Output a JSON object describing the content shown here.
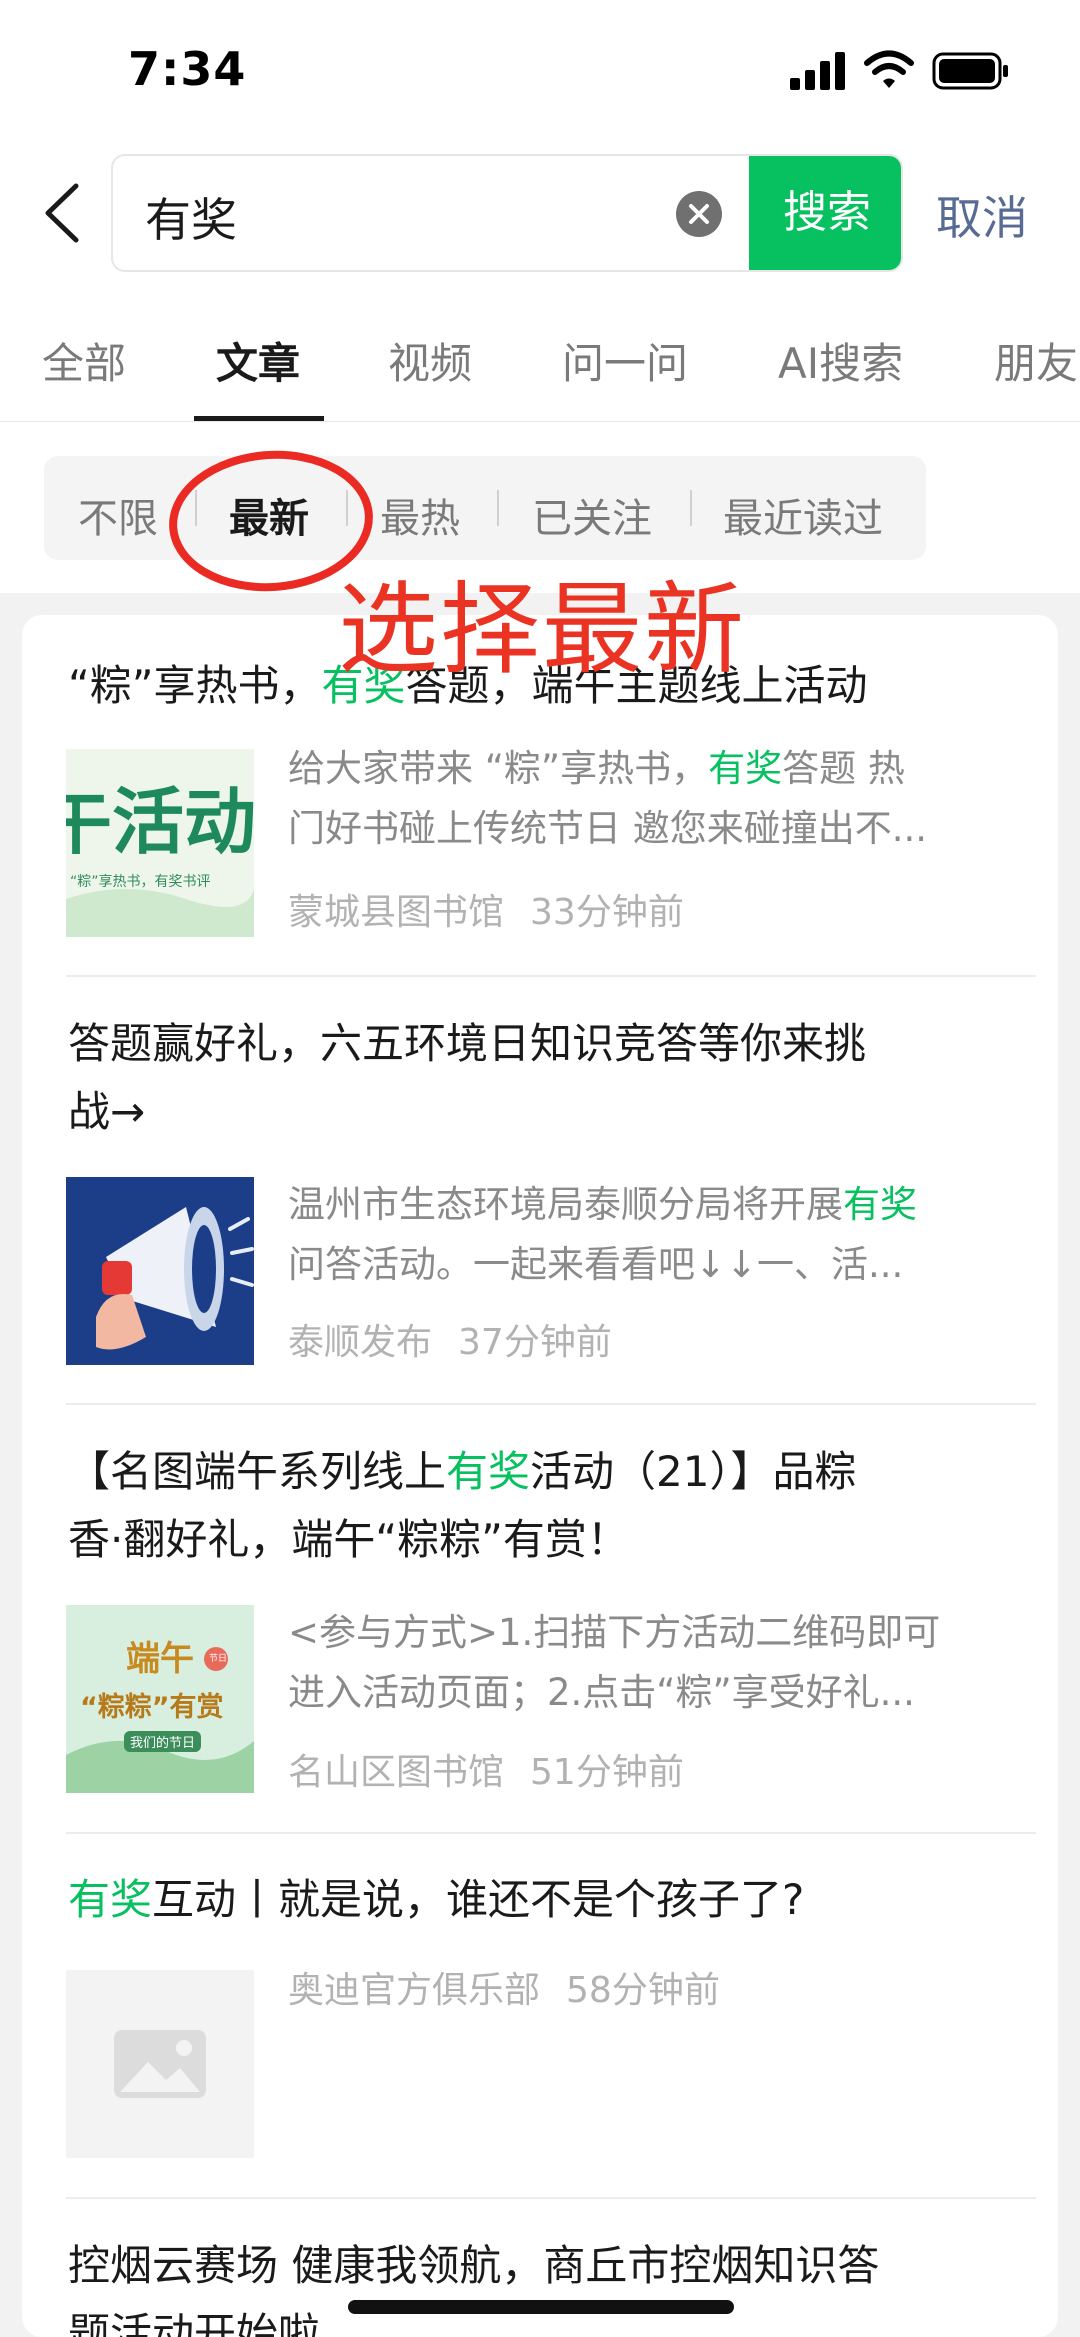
{
  "status_bar": {
    "time": "7:34"
  },
  "search": {
    "query": "有奖",
    "button_label": "搜索",
    "cancel_label": "取消"
  },
  "tabs": [
    {
      "label": "全部",
      "active": false
    },
    {
      "label": "文章",
      "active": true
    },
    {
      "label": "视频",
      "active": false
    },
    {
      "label": "问一问",
      "active": false
    },
    {
      "label": "AI搜索",
      "active": false
    },
    {
      "label": "朋友",
      "active": false
    }
  ],
  "filters": [
    {
      "label": "不限",
      "active": false
    },
    {
      "label": "最新",
      "active": true
    },
    {
      "label": "最热",
      "active": false
    },
    {
      "label": "已关注",
      "active": false
    },
    {
      "label": "最近读过",
      "active": false
    }
  ],
  "annotation": {
    "text": "选择最新"
  },
  "results": [
    {
      "title_parts": [
        "“粽”享热书，",
        "有奖",
        "答题，端午主题线上活动"
      ],
      "thumb_text": {
        "big": "午活动",
        "small": "“粽”享热书，有奖书评"
      },
      "snippet_line1_parts": [
        "给大家带来 “粽”享热书，",
        "有奖",
        "答题 热"
      ],
      "snippet_line2": "门好书碰上传统节日 邀您来碰撞出不...",
      "source": "蒙城县图书馆",
      "time": "33分钟前"
    },
    {
      "title_line1": "答题赢好礼，六五环境日知识竞答等你来挑",
      "title_line2": "战→",
      "snippet_line1_parts": [
        "温州市生态环境局泰顺分局将开展",
        "有奖"
      ],
      "snippet_line2": "问答活动。一起来看看吧↓↓一、活...",
      "source": "泰顺发布",
      "time": "37分钟前"
    },
    {
      "title_line1_parts": [
        "【名图端午系列线上",
        "有奖",
        "活动（21）】品粽"
      ],
      "title_line2": "香·翻好礼，端午“粽粽”有赏！",
      "thumb_text": {
        "line1": "端午",
        "badge": "节日",
        "line2": "“粽粽”有赏",
        "tag": "我们的节日"
      },
      "snippet_line1": "<参与方式>1.扫描下方活动二维码即可",
      "snippet_line2": "进入活动页面；2.点击“粽”享受好礼...",
      "source": "名山区图书馆",
      "time": "51分钟前"
    },
    {
      "title_parts": [
        "有奖",
        "互动丨就是说，谁还不是个孩子了?"
      ],
      "source": "奥迪官方俱乐部",
      "time": "58分钟前"
    },
    {
      "title_line1": "控烟云赛场 健康我领航，商丘市控烟知识答",
      "title_line2": "题活动开始啦"
    }
  ]
}
